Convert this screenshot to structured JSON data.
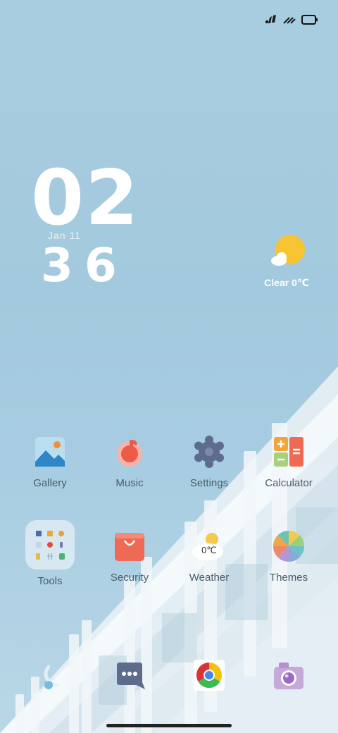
{
  "status_bar": {
    "icons": [
      "signal-icon",
      "wifi-icon",
      "battery-icon"
    ]
  },
  "clock": {
    "hour": "02",
    "date": "Jan 11",
    "minute": "36"
  },
  "weather_widget": {
    "label": "Clear 0℃",
    "icon": "sun-cloud-icon"
  },
  "apps": {
    "row1": [
      {
        "label": "Gallery",
        "icon": "gallery-icon"
      },
      {
        "label": "Music",
        "icon": "music-icon"
      },
      {
        "label": "Settings",
        "icon": "gear-icon"
      },
      {
        "label": "Calculator",
        "icon": "calculator-icon"
      }
    ],
    "row2": [
      {
        "label": "Tools",
        "icon": "folder-icon"
      },
      {
        "label": "Security",
        "icon": "security-bag-icon"
      },
      {
        "label": "Weather",
        "icon": "weather-icon",
        "badge": "0℃"
      },
      {
        "label": "Themes",
        "icon": "themes-icon"
      }
    ]
  },
  "dock": [
    {
      "icon": "phone-icon"
    },
    {
      "icon": "messages-icon"
    },
    {
      "icon": "chrome-icon"
    },
    {
      "icon": "camera-icon"
    }
  ],
  "colors": {
    "sky": "#a9cde0",
    "label": "#4b5d6a"
  }
}
